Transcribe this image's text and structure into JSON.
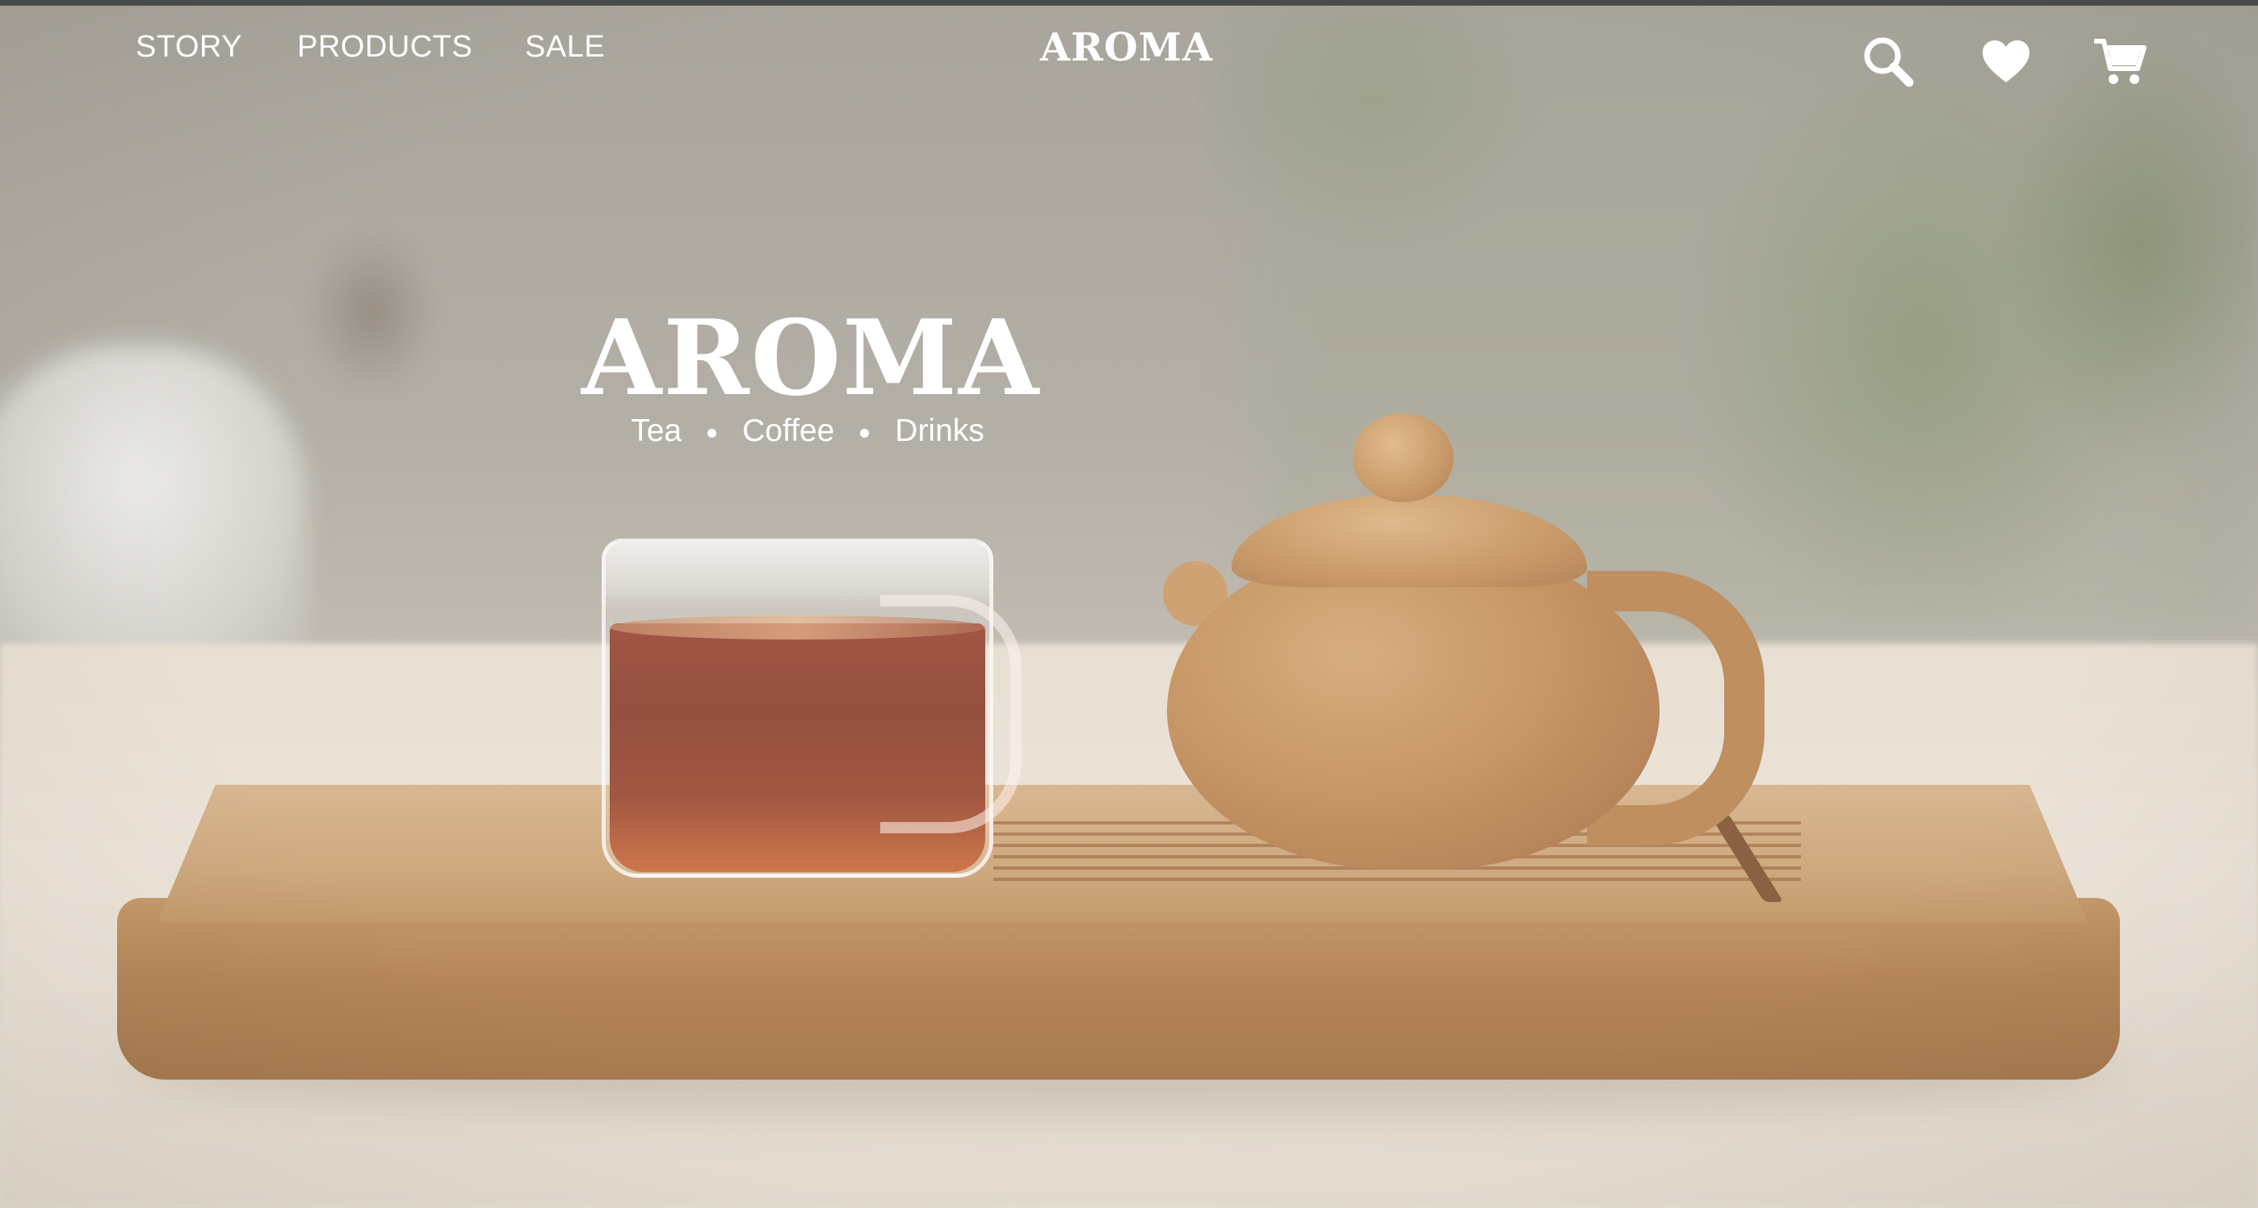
{
  "nav": {
    "links": [
      {
        "label": "STORY"
      },
      {
        "label": "PRODUCTS"
      },
      {
        "label": "SALE"
      }
    ],
    "logo": "AROMA",
    "icons": [
      "search-icon",
      "heart-icon",
      "cart-icon"
    ]
  },
  "hero": {
    "title": "AROMA",
    "tagline": [
      "Tea",
      "Coffee",
      "Drinks"
    ]
  },
  "colors": {
    "text": "#ffffff",
    "tea": "#7a2410",
    "wood": "#c69a6b",
    "clay": "#c99a69"
  }
}
